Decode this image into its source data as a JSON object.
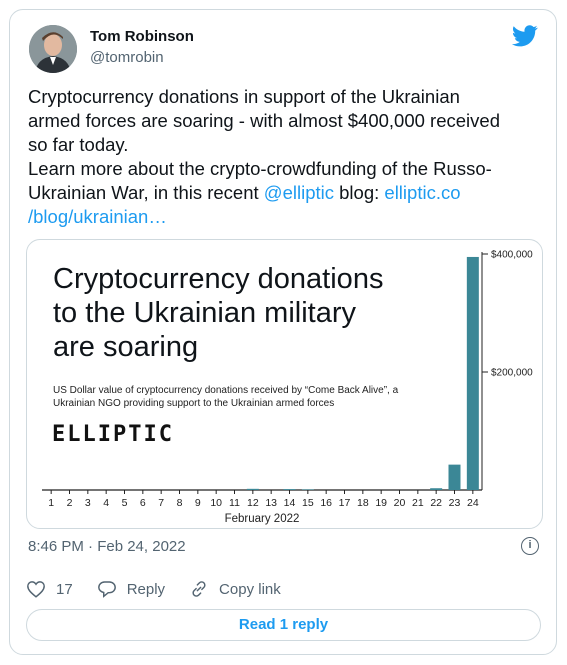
{
  "author": {
    "name": "Tom Robinson",
    "handle": "@tomrobin"
  },
  "tweet": {
    "line1": "Cryptocurrency donations in support of the Ukrainian",
    "line2": "armed forces are soaring - with almost $400,000 received",
    "line3": "so far today.",
    "line4": "Learn more about the crypto-crowdfunding of the Russo-",
    "line5_pre": "Ukrainian War, in this recent ",
    "mention": "@elliptic",
    "line5_mid": " blog: ",
    "link1": "elliptic.co",
    "link2": "/blog/ukrainian…"
  },
  "media": {
    "headline": [
      "Cryptocurrency donations",
      "to the Ukrainian military",
      "are soaring"
    ],
    "subtitle": [
      "US Dollar value of cryptocurrency donations received by “Come Back Alive”, a",
      "Ukrainian NGO providing support to the Ukrainian armed forces"
    ],
    "brand": "ELLIPTIC"
  },
  "chart_data": {
    "type": "bar",
    "categories": [
      "1",
      "2",
      "3",
      "4",
      "5",
      "6",
      "7",
      "8",
      "9",
      "10",
      "11",
      "12",
      "13",
      "14",
      "15",
      "16",
      "17",
      "18",
      "19",
      "20",
      "21",
      "22",
      "23",
      "24"
    ],
    "values": [
      0,
      0,
      0,
      0,
      0,
      0,
      0,
      0,
      0,
      0,
      0,
      2000,
      0,
      1500,
      1000,
      0,
      0,
      0,
      0,
      0,
      0,
      3000,
      43000,
      395000
    ],
    "xlabel": "February 2022",
    "yticks": [
      {
        "value": 400000,
        "label": "$400,000"
      },
      {
        "value": 200000,
        "label": "$200,000"
      }
    ],
    "ylim": [
      0,
      400000
    ],
    "color": "#3b8796"
  },
  "meta": {
    "timestamp": "8:46 PM · Feb 24, 2022",
    "likes": "17",
    "reply_label": "Reply",
    "copy_label": "Copy link",
    "read_replies": "Read 1 reply"
  },
  "icons": [
    "bird-icon",
    "info-icon",
    "heart-icon",
    "reply-icon",
    "link-icon"
  ],
  "colors": {
    "accent": "#1d9bf0",
    "muted": "#536471",
    "bar": "#3b8796"
  }
}
